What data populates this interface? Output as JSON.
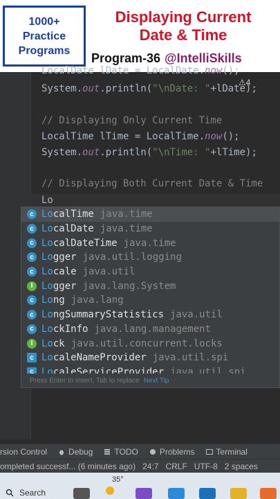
{
  "banner": {
    "badge_lines": [
      "1000+",
      "Practice",
      "Programs"
    ],
    "title_line1": "Displaying Current",
    "title_line2": "Date & Time",
    "program": "Program-36",
    "handle": "@IntelliSkills"
  },
  "editor": {
    "lines": {
      "l1a": "LocalDate lDate = LocalDate.",
      "l1b": "now",
      "l1c": "();",
      "l2a": "System.",
      "l2b": "out",
      "l2c": ".println(",
      "l2d": "\"\\nDate: \"",
      "l2e": "+lDate);",
      "c1": "// Displaying Only Current Time",
      "l3a": "LocalTime lTime = LocalTime.",
      "l3b": "now",
      "l3c": "();",
      "l4a": "System.",
      "l4b": "out",
      "l4c": ".println(",
      "l4d": "\"\\nTime: \"",
      "l4e": "+lTime);",
      "c2": "// Displaying Both Current Date & Time",
      "typed": "Lo"
    },
    "inspection_hint": "⚠4"
  },
  "autocomplete": {
    "items": [
      {
        "match": "Lo",
        "rest": "calTime",
        "pkg": "java.time",
        "icon": "class-icon"
      },
      {
        "match": "Lo",
        "rest": "calDate",
        "pkg": "java.time",
        "icon": "class-icon"
      },
      {
        "match": "Lo",
        "rest": "calDateTime",
        "pkg": "java.time",
        "icon": "class-icon"
      },
      {
        "match": "Lo",
        "rest": "gger",
        "pkg": "java.util.logging",
        "icon": "class-icon"
      },
      {
        "match": "Lo",
        "rest": "cale",
        "pkg": "java.util",
        "icon": "class-icon"
      },
      {
        "match": "Lo",
        "rest": "gger",
        "pkg": "java.lang.System",
        "icon": "interface-icon"
      },
      {
        "match": "Lo",
        "rest": "ng",
        "pkg": "java.lang",
        "icon": "class-icon"
      },
      {
        "match": "Lo",
        "rest": "ngSummaryStatistics",
        "pkg": "java.util",
        "icon": "class-icon"
      },
      {
        "match": "Lo",
        "rest": "ckInfo",
        "pkg": "java.lang.management",
        "icon": "class-icon"
      },
      {
        "match": "Lo",
        "rest": "ck",
        "pkg": "java.util.concurrent.locks",
        "icon": "interface-icon"
      },
      {
        "match": "Lo",
        "rest": "caleNameProvider",
        "pkg": "java.util.spi",
        "icon": "abstract-class-icon"
      },
      {
        "match": "Lo",
        "rest": "caleServiceProvider",
        "pkg": "java.util.spi",
        "icon": "abstract-class-icon"
      }
    ],
    "footer_hint": "Press Enter to insert, Tab to replace",
    "next_tip": "Next Tip"
  },
  "toolwindows": {
    "version_control": "rsion Control",
    "debug": "Debug",
    "todo": "TODO",
    "problems": "Problems",
    "terminal": "Terminal"
  },
  "statusbar": {
    "message": "ompleted successf... (6 minutes ago)",
    "position": "24:7",
    "line_sep": "CRLF",
    "encoding": "UTF-8",
    "indent": "2 spaces"
  },
  "taskbar": {
    "search_label": "Search",
    "temperature": "35°"
  },
  "colors": {
    "banner_title": "#d0142a",
    "badge_blue": "#1a3f9e",
    "editor_bg": "#2b2b2b",
    "popup_bg": "#3c3f41"
  }
}
